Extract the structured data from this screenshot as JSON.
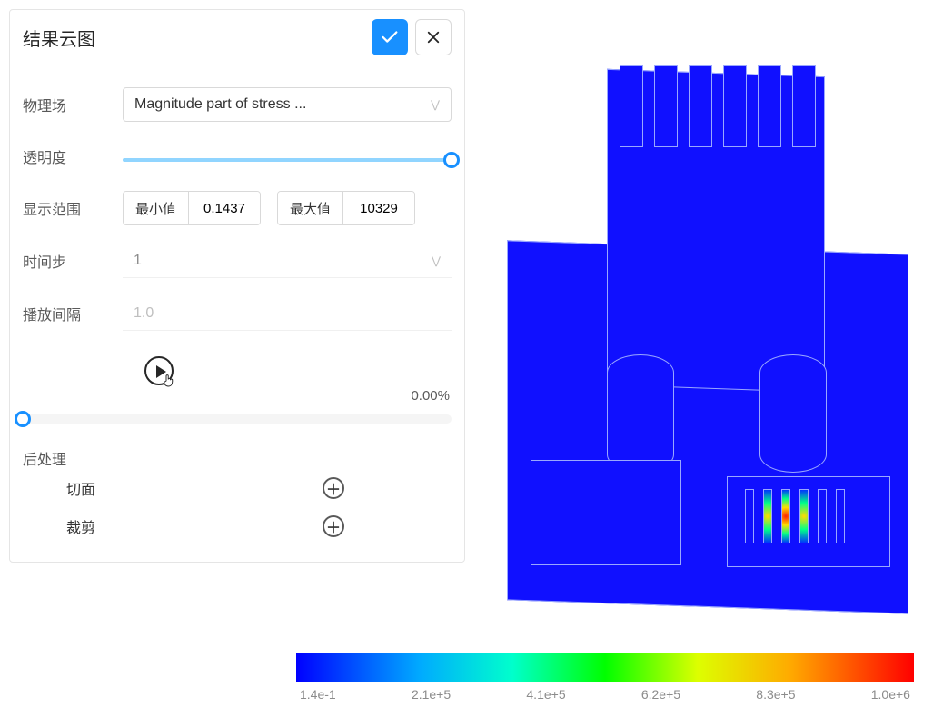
{
  "panel": {
    "title": "结果云图",
    "physics": {
      "label": "物理场",
      "value": "Magnitude part of stress ..."
    },
    "opacity": {
      "label": "透明度",
      "value": 1.0
    },
    "range": {
      "label": "显示范围",
      "min_button": "最小值",
      "min_value": "0.1437",
      "max_button": "最大值",
      "max_value": "10329"
    },
    "timestep": {
      "label": "时间步",
      "value": "1"
    },
    "interval": {
      "label": "播放间隔",
      "value": "1.0"
    },
    "percent": "0.00%",
    "post": {
      "section": "后处理",
      "cut": "切面",
      "crop": "裁剪"
    }
  },
  "legend": {
    "ticks": [
      "1.4e-1",
      "2.1e+5",
      "4.1e+5",
      "6.2e+5",
      "8.3e+5",
      "1.0e+6"
    ]
  },
  "colors": {
    "accent": "#1890ff"
  }
}
